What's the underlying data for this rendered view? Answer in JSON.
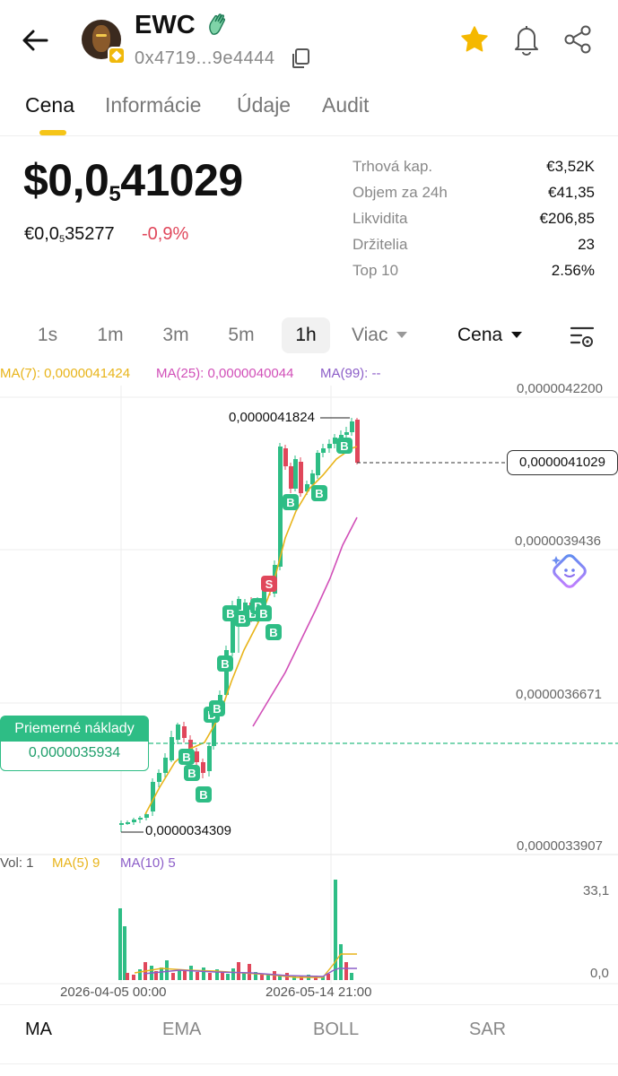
{
  "header": {
    "token_name": "EWC",
    "address": "0x4719...9e4444"
  },
  "tabs": [
    {
      "label": "Cena",
      "active": true
    },
    {
      "label": "Informácie",
      "active": false
    },
    {
      "label": "Údaje",
      "active": false
    },
    {
      "label": "Audit",
      "active": false
    }
  ],
  "price": {
    "usd_prefix": "$0,0",
    "usd_sub": "5",
    "usd_digits": "41029",
    "eur_prefix": "€0,0",
    "eur_sub": "5",
    "eur_digits": "35277",
    "change": "-0,9%"
  },
  "stats": [
    {
      "label": "Trhová kap.",
      "value": "€3,52K"
    },
    {
      "label": "Objem za 24h",
      "value": "€41,35"
    },
    {
      "label": "Likvidita",
      "value": "€206,85"
    },
    {
      "label": "Držitelia",
      "value": "23"
    },
    {
      "label": "Top 10",
      "value": "2.56%"
    }
  ],
  "timeframes": {
    "items": [
      "1s",
      "1m",
      "3m",
      "5m",
      "1h"
    ],
    "selected": "1h",
    "more_label": "Viac",
    "series_label": "Cena"
  },
  "chart": {
    "ma_legend": {
      "ma7": "MA(7): 0,0000041424",
      "ma25": "MA(25): 0,0000040044",
      "ma99": "MA(99): --"
    },
    "y_labels": [
      "0,0000042200",
      "0,0000039436",
      "0,0000036671",
      "0,0000033907"
    ],
    "last_price": "0,0000041029",
    "high_label": "0,0000041824",
    "low_label": "0,0000034309",
    "avg_cost_title": "Priemerné náklady",
    "avg_cost_value": "0,0000035934",
    "vol_legend": {
      "vol": "Vol: 1",
      "ma5": "MA(5) 9",
      "ma10": "MA(10) 5"
    },
    "vol_y_labels": [
      "33,1",
      "0,0"
    ],
    "dates": [
      "2026-04-05 00:00",
      "2026-05-14 21:00"
    ],
    "trade_markers": {
      "buy": "B",
      "sell": "S"
    }
  },
  "indicators": [
    "MA",
    "EMA",
    "BOLL",
    "SAR"
  ],
  "colors": {
    "up": "#2ebd85",
    "down": "#e0475b",
    "ma7": "#e8b41a",
    "ma25": "#d14fb8",
    "ma99": "#8c5ec8",
    "accent": "#f5c518"
  }
}
